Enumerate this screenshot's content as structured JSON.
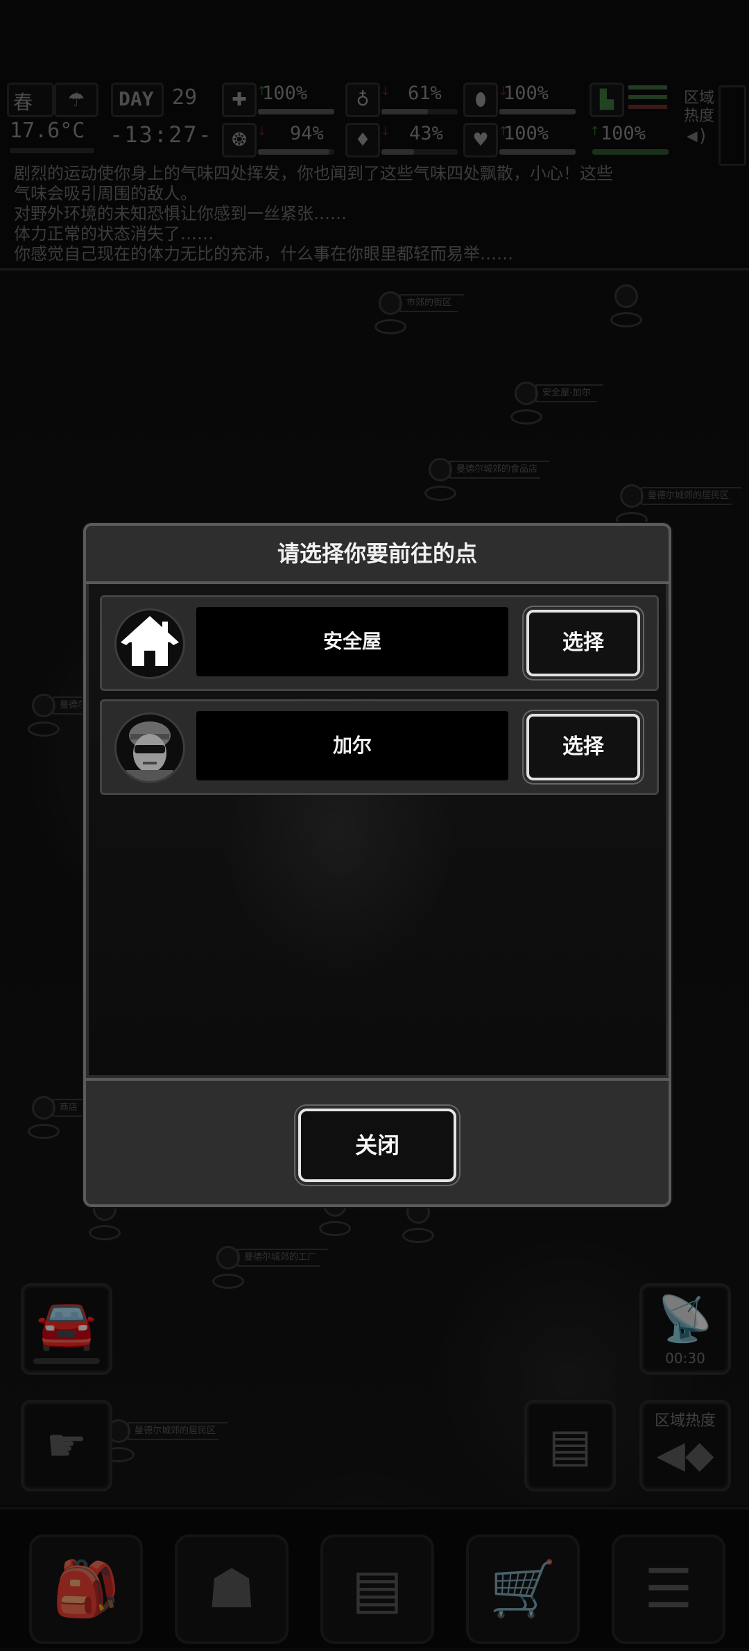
{
  "hud": {
    "season": "春",
    "temperature": "17.6°C",
    "day_label": "DAY",
    "day_number": "29",
    "clock": "-13:27-",
    "zone_heat_label": "区域热度",
    "stats": [
      {
        "icon": "medkit-icon",
        "value": "100%",
        "trend": "up",
        "level": 1.0
      },
      {
        "icon": "stomach-icon",
        "value": "61%",
        "trend": "down",
        "level": 0.61
      },
      {
        "icon": "capsule-icon",
        "value": "100%",
        "trend": "down",
        "level": 1.0
      },
      {
        "icon": "brain-icon",
        "value": "94%",
        "trend": "down",
        "level": 0.94
      },
      {
        "icon": "water-drop-icon",
        "value": "43%",
        "trend": "down",
        "level": 0.43
      },
      {
        "icon": "heart-icon",
        "value": "100%",
        "trend": "up",
        "level": 1.0
      },
      {
        "icon": "boot-icon",
        "value": "100%",
        "trend": "up",
        "level": 1.0
      }
    ]
  },
  "log": [
    "剧烈的运动使你身上的气味四处挥发，你也闻到了这些气味四处飘散，小心！这些",
    "气味会吸引周围的敌人。",
    "对野外环境的未知恐惧让你感到一丝紧张……",
    "体力正常的状态消失了……",
    "你感觉自己现在的体力无比的充沛，什么事在你眼里都轻而易举……"
  ],
  "map_labels": [
    "安全屋-加尔",
    "曼德尔城郊的食品店",
    "市郊的街区",
    "曼德尔城郊",
    "曼德尔城郊的工厂",
    "曼德尔城郊的居民区",
    "商店"
  ],
  "modal": {
    "title": "请选择你要前往的点",
    "destinations": [
      {
        "name": "安全屋",
        "avatar": "house-icon",
        "select_label": "选择"
      },
      {
        "name": "加尔",
        "avatar": "soldier-portrait",
        "select_label": "选择"
      }
    ],
    "close_label": "关闭"
  },
  "side_buttons": {
    "vehicle": "car-icon",
    "radio_timer": "00:30",
    "move": "tap-move-icon",
    "medical": "medical-file-icon",
    "zone_heat": "区域热度"
  },
  "bottom_nav": [
    "backpack-icon",
    "brain-skills-icon",
    "notes-icon",
    "shopping-cart-icon",
    "menu-list-icon"
  ]
}
